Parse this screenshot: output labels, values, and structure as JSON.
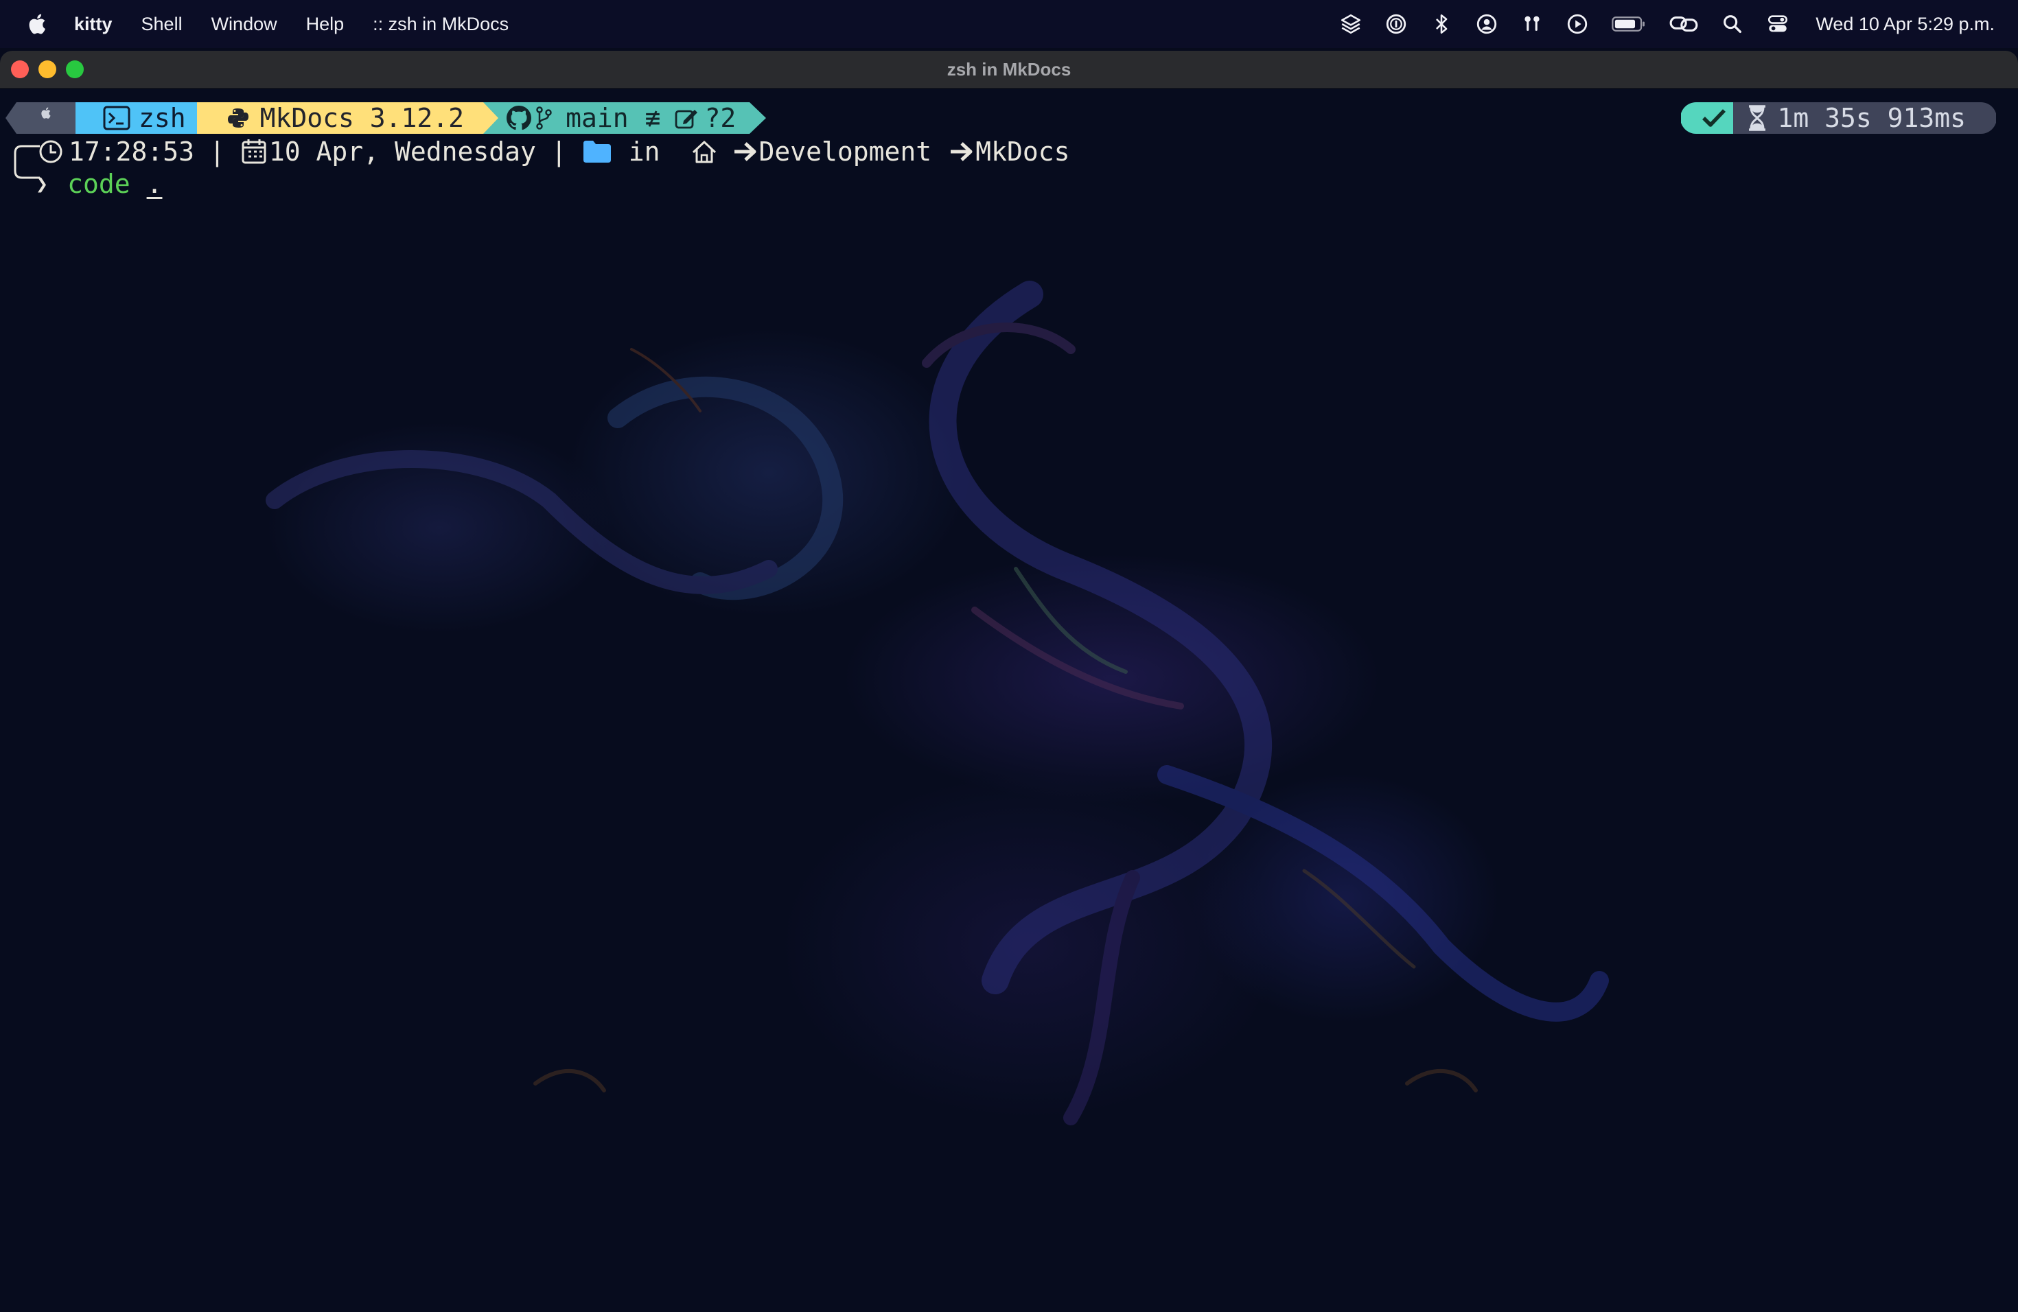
{
  "menubar": {
    "app_name": "kitty",
    "items": [
      "Shell",
      "Window",
      "Help",
      ":: zsh in MkDocs"
    ],
    "status_icons": [
      "layers-icon",
      "password-icon",
      "bluetooth-icon",
      "user-icon",
      "airpods-icon",
      "play-icon",
      "battery-icon",
      "link-icon",
      "search-icon",
      "control-center-icon"
    ],
    "clock": "Wed 10 Apr  5:29 p.m."
  },
  "window": {
    "title": "zsh in MkDocs"
  },
  "prompt": {
    "shell": "zsh",
    "python_env": "MkDocs 3.12.2",
    "git_branch": "main",
    "git_status": "≢",
    "git_untracked": "?2",
    "exec_status": "✔",
    "exec_duration": "1m 35s 913ms",
    "time": "17:28:53",
    "separator": "|",
    "date": "10 Apr, Wednesday",
    "in_label": "in",
    "path": [
      "Development",
      "MkDocs"
    ],
    "command_prompt": "❯",
    "command": "code",
    "command_arg": "."
  },
  "colors": {
    "apple_segment": "#4b5266",
    "shell_segment": "#4fc3f7",
    "python_segment": "#ffe07a",
    "git_segment": "#56c2b5",
    "status_ok": "#55d6be",
    "duration_segment": "#3f4459",
    "command_color": "#5cd157",
    "folder_icon": "#4fb3ff"
  }
}
